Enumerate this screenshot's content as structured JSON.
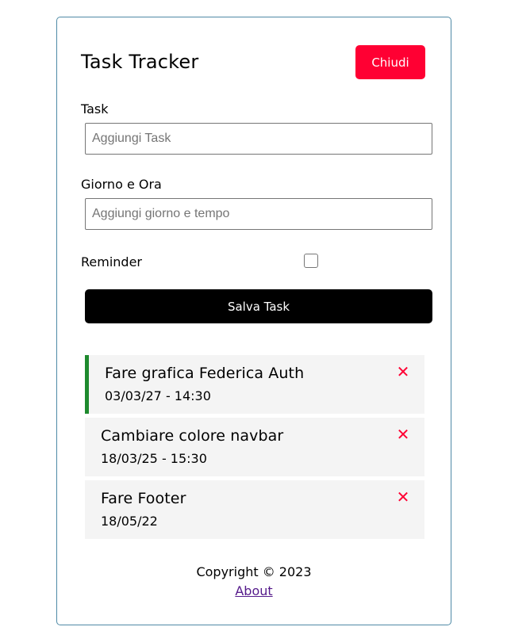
{
  "header": {
    "title": "Task Tracker",
    "close_label": "Chiudi",
    "close_color": "#ff0033"
  },
  "form": {
    "task_label": "Task",
    "task_placeholder": "Aggiungi Task",
    "day_label": "Giorno e Ora",
    "day_placeholder": "Aggiungi giorno e tempo",
    "reminder_label": "Reminder",
    "save_label": "Salva Task"
  },
  "tasks": [
    {
      "title": "Fare grafica Federica Auth",
      "date": "03/03/27 - 14:30",
      "reminder": true,
      "delete_icon": "close-x-icon"
    },
    {
      "title": "Cambiare colore navbar",
      "date": "18/03/25 - 15:30",
      "reminder": false,
      "delete_icon": "close-x-icon"
    },
    {
      "title": "Fare Footer",
      "date": "18/05/22",
      "reminder": false,
      "delete_icon": "close-x-icon"
    }
  ],
  "footer": {
    "copyright": "Copyright © 2023",
    "about_label": "About"
  },
  "colors": {
    "reminder_border": "#1e8a2e",
    "delete": "#ff0033",
    "container_border": "#4f8aa6"
  }
}
